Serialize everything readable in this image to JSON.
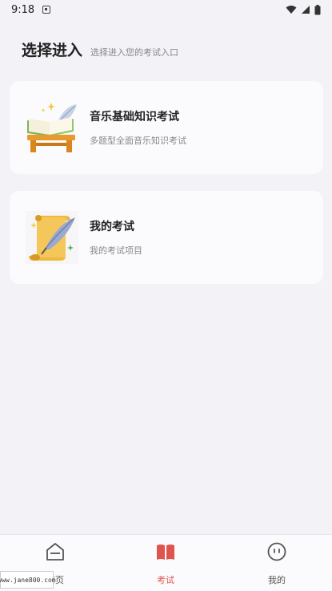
{
  "status_bar": {
    "time": "9:18",
    "icons": [
      "notification-icon",
      "wifi-icon",
      "signal-icon",
      "battery-icon"
    ]
  },
  "header": {
    "title": "选择进入",
    "subtitle": "选择进入您的考试入口"
  },
  "cards": [
    {
      "title": "音乐基础知识考试",
      "description": "多题型全面音乐知识考试",
      "icon": "open-book-on-stand-icon"
    },
    {
      "title": "我的考试",
      "description": "我的考试项目",
      "icon": "scroll-quill-icon"
    }
  ],
  "tabbar": {
    "tabs": [
      {
        "label": "首页",
        "icon": "home-icon",
        "active": false
      },
      {
        "label": "考试",
        "icon": "book-icon",
        "active": true
      },
      {
        "label": "我的",
        "icon": "profile-face-icon",
        "active": false
      }
    ],
    "active_color": "#e0544f"
  },
  "watermark": {
    "text": "www.jane800.com"
  }
}
